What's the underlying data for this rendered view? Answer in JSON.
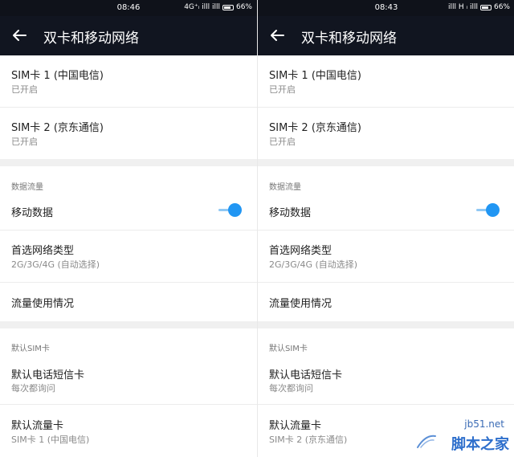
{
  "panels": [
    {
      "status": {
        "time": "08:46",
        "signal": "4G⁺ᵢ illl illl",
        "battery": "66%"
      },
      "appbar": {
        "title": "双卡和移动网络"
      },
      "sim1": {
        "title": "SIM卡 1 (中国电信)",
        "sub": "已开启"
      },
      "sim2": {
        "title": "SIM卡 2 (京东通信)",
        "sub": "已开启"
      },
      "data_section": {
        "header": "数据流量",
        "mobile_data": "移动数据",
        "mobile_data_on": true,
        "network_type": {
          "title": "首选网络类型",
          "sub": "2G/3G/4G (自动选择)"
        },
        "usage": "流量使用情况"
      },
      "sim_section": {
        "header": "默认SIM卡",
        "default_call": {
          "title": "默认电话短信卡",
          "sub": "每次都询问"
        },
        "default_data": {
          "title": "默认流量卡",
          "sub": "SIM卡 1 (中国电信)"
        }
      }
    },
    {
      "status": {
        "time": "08:43",
        "signal": "illl H ᵢ illl",
        "battery": "66%"
      },
      "appbar": {
        "title": "双卡和移动网络"
      },
      "sim1": {
        "title": "SIM卡 1 (中国电信)",
        "sub": "已开启"
      },
      "sim2": {
        "title": "SIM卡 2 (京东通信)",
        "sub": "已开启"
      },
      "data_section": {
        "header": "数据流量",
        "mobile_data": "移动数据",
        "mobile_data_on": true,
        "network_type": {
          "title": "首选网络类型",
          "sub": "2G/3G/4G (自动选择)"
        },
        "usage": "流量使用情况"
      },
      "sim_section": {
        "header": "默认SIM卡",
        "default_call": {
          "title": "默认电话短信卡",
          "sub": "每次都询问"
        },
        "default_data": {
          "title": "默认流量卡",
          "sub": "SIM卡 2 (京东通信)"
        }
      }
    }
  ],
  "watermark": {
    "url": "jb51.net",
    "brand": "脚本之家"
  },
  "colors": {
    "appbar": "#111520",
    "toggle_thumb": "#2196f3",
    "toggle_track": "#90c8f4",
    "watermark": "#2e6fcc"
  }
}
